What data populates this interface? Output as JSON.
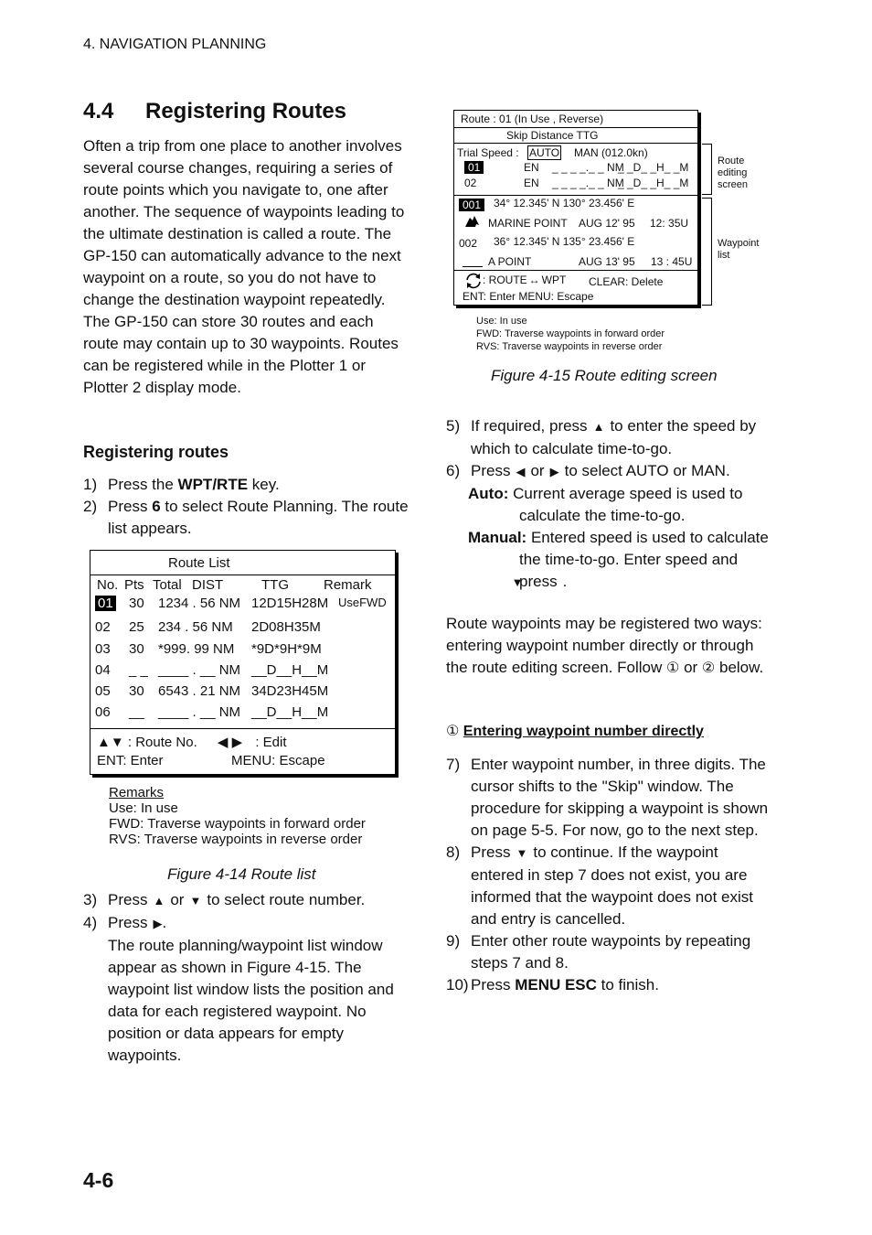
{
  "header": {
    "running_head": "4. NAVIGATION PLANNING"
  },
  "section": {
    "number": "4.4",
    "title": "Registering Routes"
  },
  "intro": [
    "Often a trip from one place to another involves several course changes, requiring a series of route points which you navigate to, one after another. The sequence of waypoints leading to the ultimate destination is called a route. The GP-150 can automatically advance to the next waypoint on a route, so you do not have to change the destination waypoint repeatedly.",
    "The GP-150 can store 30 routes and each route may contain up to 30 waypoints. Routes can be registered while in the Plotter 1 or Plotter 2 display mode."
  ],
  "subhead": "Registering routes",
  "steps_left_a": [
    {
      "n": "1)",
      "pre": "Press the ",
      "bold": "WPT/RTE",
      "post": " key."
    },
    {
      "n": "2)",
      "pre": "Press ",
      "bold": "6",
      "post": " to select Route Planning. The route list appears."
    }
  ],
  "route_list": {
    "title": "Route List",
    "headers": {
      "no": "No.",
      "pts": "Pts",
      "total": "Total",
      "dist": "DIST",
      "ttg": "TTG",
      "remark": "Remark"
    },
    "rows": [
      {
        "no": "01",
        "pts": "30",
        "dist": "1234 . 56 NM",
        "ttg": "12D15H28M",
        "remark": "UseFWD",
        "selected": true
      },
      {
        "no": "02",
        "pts": "25",
        "dist": "234 . 56 NM",
        "ttg": "2D08H35M",
        "remark": ""
      },
      {
        "no": "03",
        "pts": "30",
        "dist": "*999. 99 NM",
        "ttg": "*9D*9H*9M",
        "remark": ""
      },
      {
        "no": "04",
        "pts": "_ _",
        "dist": "____ . __ NM",
        "ttg": "__D__H__M",
        "remark": ""
      },
      {
        "no": "05",
        "pts": "30",
        "dist": "6543 . 21 NM",
        "ttg": "34D23H45M",
        "remark": ""
      },
      {
        "no": "06",
        "pts": "__",
        "dist": "____ . __ NM",
        "ttg": "__D__H__M",
        "remark": ""
      }
    ],
    "footer": {
      "updown": "▲▼",
      "route_no": ": Route No.",
      "leftright": "◀ ▶",
      "edit": ": Edit",
      "enter": "ENT: Enter",
      "escape": "MENU: Escape"
    }
  },
  "remarks": {
    "title": "Remarks",
    "lines": [
      "Use: In use",
      "FWD: Traverse waypoints in forward order",
      "RVS: Traverse waypoints in reverse order"
    ]
  },
  "fig14_caption": "Figure 4-14 Route list",
  "steps_left_b": {
    "s3": {
      "n": "3)",
      "pre": "Press",
      "up": "▲",
      "mid": "or",
      "down": "▼",
      "post": "to select route number."
    },
    "s4": {
      "n": "4)",
      "pre": "Press",
      "right": "▶",
      "post": "."
    },
    "s4_body": "The route planning/waypoint list window appear as shown in Figure 4-15. The waypoint list window lists the position and data for each registered waypoint. No position or data appears for empty waypoints."
  },
  "route_edit": {
    "route_line": "Route   : 01   (In Use , Reverse)",
    "skip_header": "Skip Distance     TTG",
    "trial_speed_label": "Trial Speed :",
    "auto": "AUTO",
    "man": "MAN  (012.0kn)",
    "legs": [
      {
        "no": "01",
        "en": "EN",
        "dist": "_ _ _ _._ _ NM",
        "ttg": "_ _D_ _H_ _M",
        "selected": true
      },
      {
        "no": "02",
        "en": "EN",
        "dist": "_ _ _ _._ _ NM",
        "ttg": "_ _D_ _H_ _M"
      }
    ],
    "waypoints": [
      {
        "no": "001",
        "pos": "34° 12.345' N  130° 23.456' E",
        "name": "MARINE POINT",
        "date": "AUG 12' 95",
        "time": "12: 35U",
        "selected": true
      },
      {
        "no": "002",
        "pos": "36° 12.345' N  135° 23.456' E",
        "name": "A POINT",
        "date": "AUG 13' 95",
        "time": "13 : 45U"
      }
    ],
    "footer1_a": ": ROUTE",
    "footer1_arrow": "↔",
    "footer1_b": "WPT",
    "footer1_clear": "CLEAR: Delete",
    "footer2": "ENT: Enter    MENU: Escape",
    "bracket_labels": {
      "route_editing": "Route\nediting\nscreen",
      "waypoint_list": "Waypoint\nlist"
    },
    "legend": [
      "Use: In use",
      "FWD: Traverse waypoints in forward order",
      "RVS: Traverse waypoints in reverse order"
    ]
  },
  "fig15_caption": "Figure 4-15 Route editing screen",
  "steps_right_a": {
    "s5": {
      "n": "5)",
      "pre": "If required, press",
      "up": "▲",
      "post": "to enter the speed by which to calculate time-to-go."
    },
    "s6": {
      "n": "6)",
      "pre": "Press",
      "left": "◀",
      "mid": "or",
      "right": "▶",
      "post": "to select AUTO or MAN."
    },
    "auto_label": "Auto:",
    "auto_text": "Current average speed is used to calculate the time-to-go.",
    "manual_label": "Manual:",
    "manual_text": "Entered speed is used to calculate the time-to-go. Enter speed and press",
    "manual_down": "▼",
    "manual_end": "."
  },
  "para_ways": {
    "text": "Route waypoints may be registered two ways: entering waypoint number directly or through the route editing screen. Follow",
    "c1": "①",
    "or": "or",
    "c2": "②",
    "end": "below."
  },
  "sub2": {
    "circ": "①",
    "title": "Entering waypoint number directly"
  },
  "steps_right_b": [
    {
      "n": "7)",
      "text": "Enter waypoint number, in three digits. The cursor shifts to the \"Skip\" window. The procedure for skipping a waypoint is shown on page 5-5. For now, go to the next step."
    },
    {
      "n": "8)",
      "pre": "Press",
      "down": "▼",
      "post": "to continue. If the waypoint entered in step 7 does not exist, you are informed that the waypoint does not exist and entry is cancelled."
    },
    {
      "n": "9)",
      "text": "Enter other route waypoints by repeating steps 7 and 8."
    },
    {
      "n": "10)",
      "pre": "Press ",
      "bold": "MENU ESC",
      "post": " to finish."
    }
  ],
  "page_number": "4-6"
}
